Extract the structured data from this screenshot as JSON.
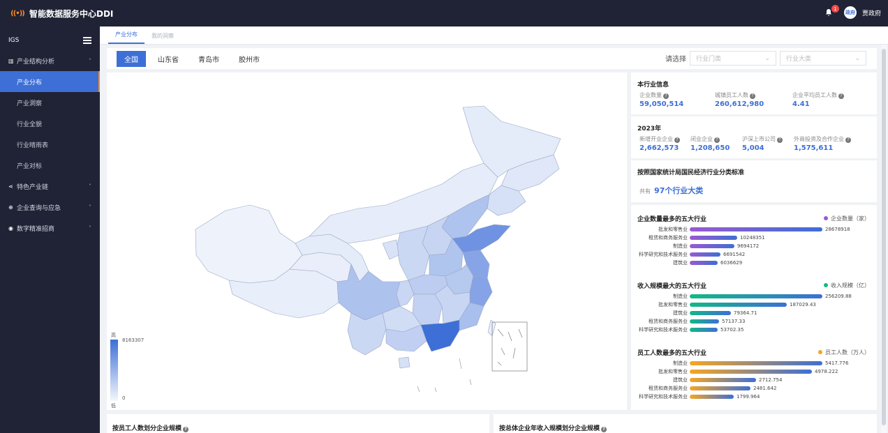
{
  "app": {
    "title": "智能数据服务中心DDI",
    "logo_glyph": "((•))",
    "notify_count": "1",
    "avatar_text": "政府",
    "username": "贾政府"
  },
  "sidebar": {
    "header": "IGS",
    "groups": [
      {
        "label": "产业结构分析",
        "icon": "chart-icon",
        "expanded": true,
        "children": [
          "产业分布",
          "产业洞察",
          "行业全貌",
          "行业晴雨表",
          "产业对标"
        ],
        "active_child": 0
      },
      {
        "label": "特色产业链",
        "icon": "share-icon"
      },
      {
        "label": "企业查询与应急",
        "icon": "search-icon"
      },
      {
        "label": "数字精准招商",
        "icon": "target-icon"
      }
    ]
  },
  "tabs": [
    "产业分布",
    "我的洞察"
  ],
  "filter": {
    "regions": [
      "全国",
      "山东省",
      "青岛市",
      "胶州市"
    ],
    "select_label": "请选择",
    "select1_placeholder": "行业门类",
    "select2_placeholder": "行业大类"
  },
  "map": {
    "legend_high": "高",
    "legend_low": "低",
    "legend_max": "8163307",
    "legend_min": "0"
  },
  "industry_info": {
    "title": "本行业信息",
    "stats": [
      {
        "label": "企业数量",
        "value": "59,050,514"
      },
      {
        "label": "城镇员工人数",
        "value": "260,612,980"
      },
      {
        "label": "企业平均员工人数",
        "value": "4.41"
      }
    ]
  },
  "year_info": {
    "year": "2023年",
    "stats": [
      {
        "label": "新增开业企业",
        "value": "2,662,573"
      },
      {
        "label": "闭业企业",
        "value": "1,208,650"
      },
      {
        "label": "沪深上市公司",
        "value": "5,004"
      },
      {
        "label": "外商投资及合作企业",
        "value": "1,575,611"
      }
    ]
  },
  "standard": {
    "title": "按照国家统计局国民经济行业分类标准",
    "total_prefix": "共有",
    "total_value": "97个行业大类"
  },
  "colors": {
    "accent": "#3d6fd6",
    "sidebar_bg": "#1f2335",
    "purple": "#9b59d0",
    "green": "#12b886",
    "orange": "#f5a623"
  },
  "top5_charts": [
    {
      "title": "企业数量最多的五大行业",
      "legend": "企业数量（家）",
      "color": "#9b59d0",
      "categories": [
        "批发和零售业",
        "租赁和商务服务业",
        "制造业",
        "科学研究和技术服务业",
        "建筑业"
      ],
      "values": [
        28678918,
        10248351,
        9694172,
        6691542,
        6036629
      ],
      "labels": [
        "28678918",
        "10248351",
        "9694172",
        "6691542",
        "6036629"
      ]
    },
    {
      "title": "收入规模最大的五大行业",
      "legend": "收入规模（亿）",
      "color": "#12b886",
      "categories": [
        "制造业",
        "批发和零售业",
        "建筑业",
        "租赁和商务服务业",
        "科学研究和技术服务业"
      ],
      "values": [
        256209.88,
        187029.43,
        79364.71,
        57137.33,
        53702.35
      ],
      "labels": [
        "256209.88",
        "187029.43",
        "79364.71",
        "57137.33",
        "53702.35"
      ]
    },
    {
      "title": "员工人数最多的五大行业",
      "legend": "员工人数（万人）",
      "color": "#f5a623",
      "categories": [
        "制造业",
        "批发和零售业",
        "建筑业",
        "租赁和商务服务业",
        "科学研究和技术服务业"
      ],
      "values": [
        5417.776,
        4978.222,
        2712.754,
        2481.642,
        1799.964
      ],
      "labels": [
        "5417.776",
        "4978.222",
        "2712.754",
        "2481.642",
        "1799.964"
      ]
    }
  ],
  "bottom": {
    "left_title": "按员工人数划分企业规模",
    "right_title": "按总体企业年收入规模划分企业规模"
  }
}
